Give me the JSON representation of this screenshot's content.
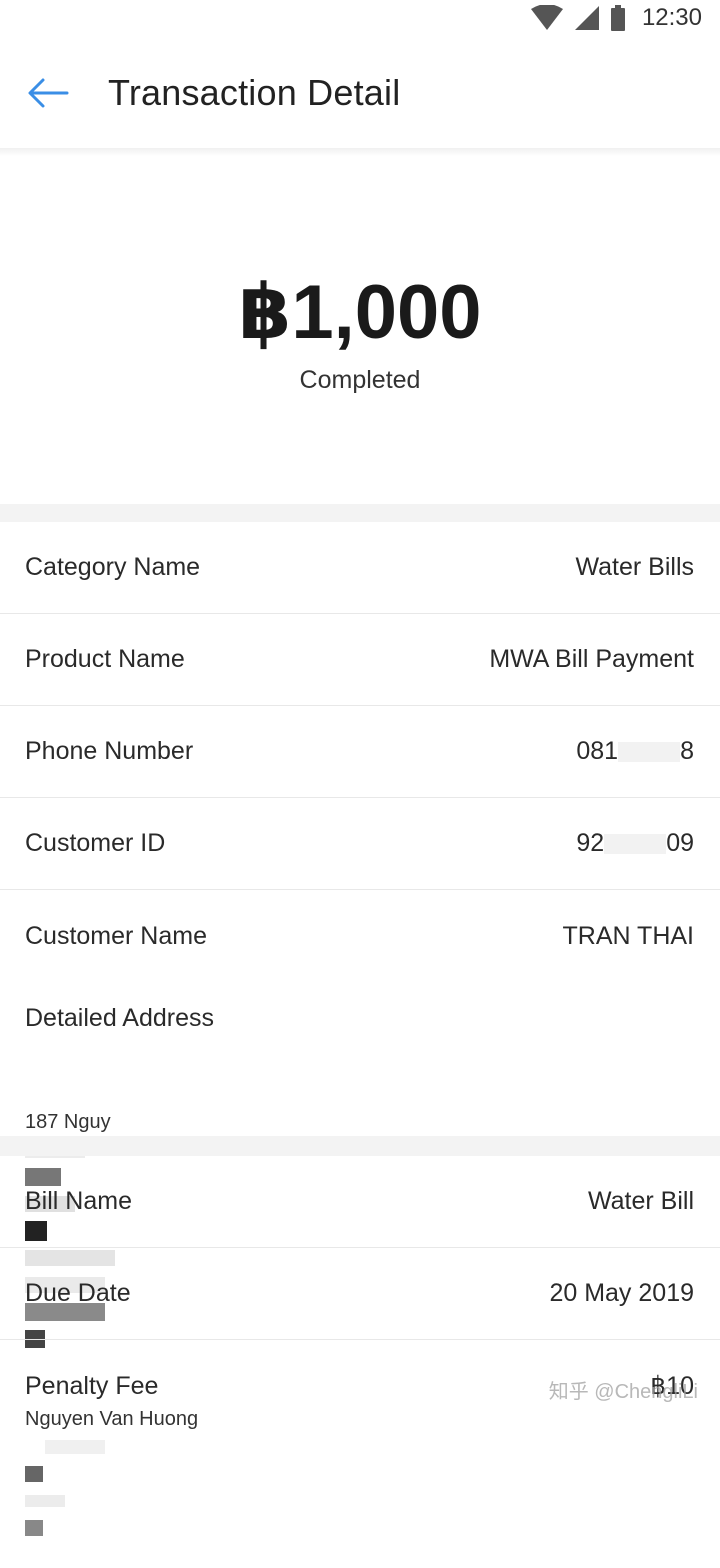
{
  "status_bar": {
    "time": "12:30",
    "icons": [
      "wifi-icon",
      "signal-icon",
      "battery-icon"
    ]
  },
  "app_bar": {
    "back_icon": "arrow-left-icon",
    "title": "Transaction Detail"
  },
  "summary": {
    "amount": "฿1,000",
    "status": "Completed"
  },
  "details": [
    {
      "label": "Category Name",
      "value": "Water Bills"
    },
    {
      "label": "Product Name",
      "value": "MWA Bill Payment"
    },
    {
      "label": "Phone Number",
      "value": "081",
      "value_tail": "8"
    },
    {
      "label": "Customer ID",
      "value": "92",
      "value_tail": "09"
    },
    {
      "label": "Customer Name",
      "value": "TRAN THAI"
    }
  ],
  "address": {
    "label": "Detailed Address",
    "line1": "187 Nguy",
    "line2": "Nguyen Van Huong"
  },
  "bill": [
    {
      "label": "Bill Name",
      "value": "Water Bill"
    },
    {
      "label": "Due Date",
      "value": "20 May 2019"
    },
    {
      "label": "Penalty Fee",
      "value": "฿10"
    }
  ],
  "watermark": "知乎 @ChengliLi",
  "colors": {
    "accent": "#3a8ee6",
    "divider": "#e8e8e8",
    "section_gap": "#f3f3f3"
  }
}
